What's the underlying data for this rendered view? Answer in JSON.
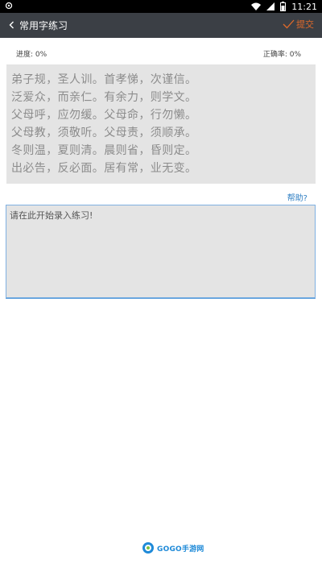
{
  "status_bar": {
    "time": "11:21",
    "icons": [
      "notification-icon",
      "wifi-icon",
      "signal-icon",
      "battery-icon"
    ]
  },
  "app_bar": {
    "title": "常用字练习",
    "submit_label": "提交",
    "accent_color": "#e06a2a"
  },
  "stats": {
    "progress": "进度: 0%",
    "accuracy": "正确率: 0%"
  },
  "reference_text": [
    "弟子规，圣人训。首孝悌，次谨信。",
    "泛爱众，而亲仁。有余力，则学文。",
    "父母呼，应勿缓。父母命，行勿懒。",
    "父母教，须敬听。父母责，须顺承。",
    "冬则温，夏则清。晨则省，昏则定。",
    "出必告，反必面。居有常，业无变。"
  ],
  "help_link": "帮助?",
  "input": {
    "placeholder": "请在此开始录入练习!",
    "value": ""
  },
  "watermark": {
    "brand": "GOGO手游网"
  }
}
